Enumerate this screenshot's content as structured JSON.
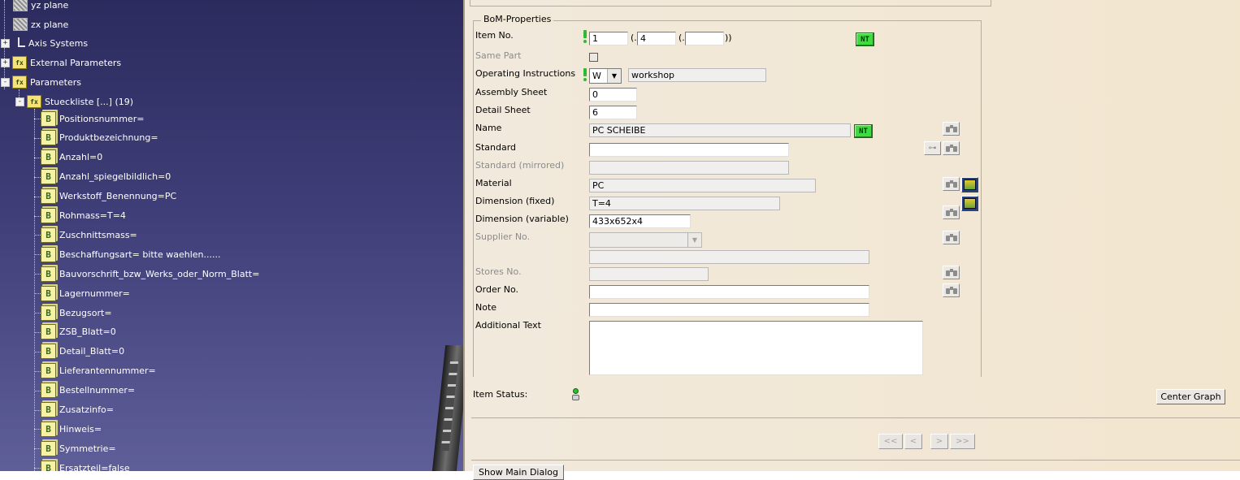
{
  "tree": {
    "nodes": [
      {
        "label": "yz plane",
        "icon": "plane-icon"
      },
      {
        "label": "zx plane",
        "icon": "plane-icon"
      },
      {
        "label": "Axis Systems",
        "icon": "axis-system-icon",
        "expander": "+"
      },
      {
        "label": "External Parameters",
        "icon": "parameter-set-icon",
        "expander": "+"
      },
      {
        "label": "Parameters",
        "icon": "parameter-set-icon",
        "expander": "-"
      },
      {
        "label": "Stueckliste [...] (19)",
        "icon": "parameter-set-icon",
        "expander": "-"
      }
    ],
    "parameters": [
      "Positionsnummer=",
      "Produktbezeichnung=",
      "Anzahl=0",
      "Anzahl_spiegelbildlich=0",
      "Werkstoff_Benennung=PC",
      "Rohmass=T=4",
      "Zuschnittsmass=",
      "Beschaffungsart=       bitte waehlen......",
      "Bauvorschrift_bzw_Werks_oder_Norm_Blatt=",
      "Lagernummer=",
      "Bezugsort=",
      "ZSB_Blatt=0",
      "Detail_Blatt=0",
      "Lieferantennummer=",
      "Bestellnummer=",
      "Zusatzinfo=",
      "Hinweis=",
      "Symmetrie=",
      "Ersatzteil=false"
    ]
  },
  "bom": {
    "group_title": "BoM-Properties",
    "labels": {
      "item_no": "Item No.",
      "same_part": "Same Part",
      "operating_instructions": "Operating Instructions",
      "assembly_sheet": "Assembly Sheet",
      "detail_sheet": "Detail Sheet",
      "name": "Name",
      "standard": "Standard",
      "standard_mirrored": "Standard (mirrored)",
      "material": "Material",
      "dimension_fixed": "Dimension (fixed)",
      "dimension_variable": "Dimension (variable)",
      "supplier_no": "Supplier No.",
      "stores_no": "Stores No.",
      "order_no": "Order No.",
      "note": "Note",
      "additional_text": "Additional Text"
    },
    "values": {
      "item_no_1": "1",
      "item_no_2": "4",
      "item_no_3": "",
      "sep_open_1": "(.",
      "sep_open_2": "(.",
      "sep_close": "))",
      "operating_code": "W",
      "operating_text": "workshop",
      "assembly_sheet": "0",
      "detail_sheet": "6",
      "name": "PC SCHEIBE",
      "standard": "",
      "standard_mirrored": "",
      "material": "PC",
      "dimension_fixed": "T=4",
      "dimension_variable": "433x652x4",
      "supplier_no": "",
      "supplier_extra": "",
      "stores_no": "",
      "order_no": "",
      "note": "",
      "additional_text": ""
    },
    "nt_label": "NT",
    "item_status_label": "Item Status:",
    "center_graph": "Center Graph",
    "nav": {
      "first": "<<",
      "prev": "<",
      "next": ">",
      "last": ">>"
    },
    "bottom_button": "Show Main Dialog"
  }
}
